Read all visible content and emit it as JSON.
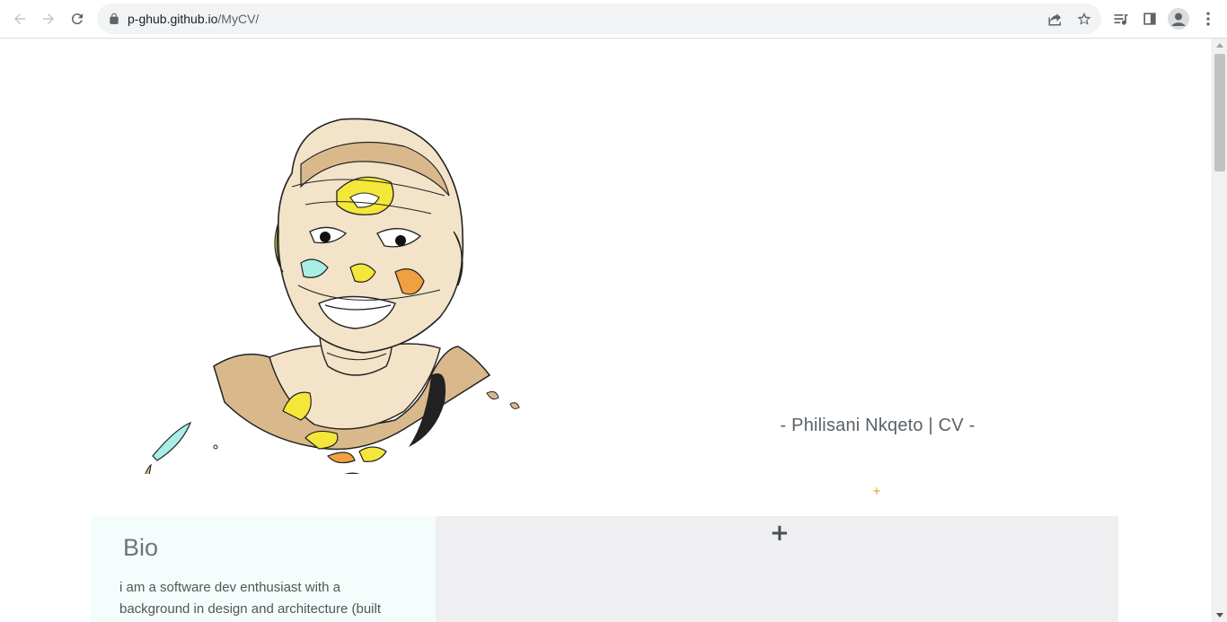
{
  "browser": {
    "url_host": "p-ghub.github.io",
    "url_path": "/MyCV/"
  },
  "page": {
    "title": "- Philisani Nkqeto | CV -",
    "small_plus": "+",
    "bio": {
      "heading": "Bio",
      "text": "i am a software dev enthusiast with a background in design and architecture (built"
    },
    "expand_plus": "+"
  },
  "icons": [
    "back-arrow-icon",
    "forward-arrow-icon",
    "reload-icon",
    "lock-icon",
    "share-icon",
    "star-icon",
    "media-queue-icon",
    "side-panel-icon",
    "profile-icon",
    "menu-dots-icon"
  ],
  "colors": {
    "title": "#5a6268",
    "bio_bg": "#f4fdfc",
    "right_panel_bg": "#efeff1",
    "accent_plus": "#d4a017"
  }
}
